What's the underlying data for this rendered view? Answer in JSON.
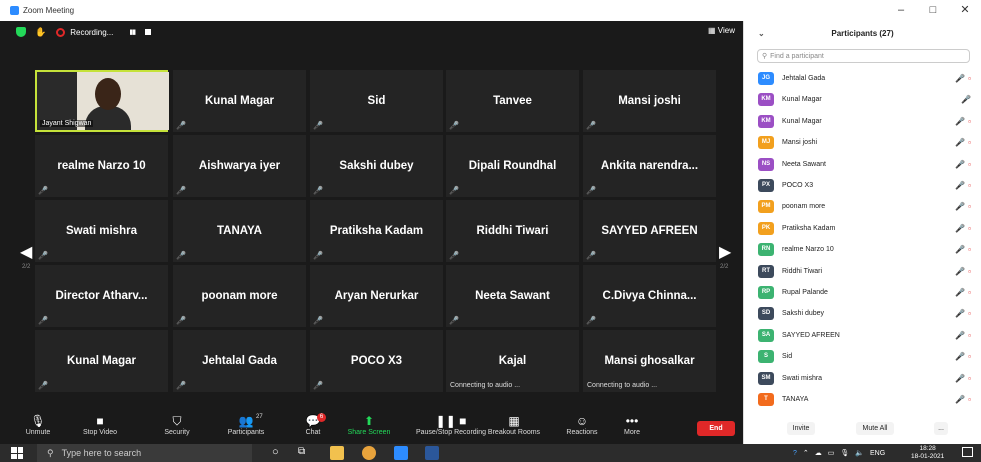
{
  "window": {
    "title": "Zoom Meeting",
    "controls": [
      "–",
      "□",
      "✕"
    ]
  },
  "topbar": {
    "recording_label": "Recording...",
    "view_label": "View"
  },
  "active_speaker": {
    "name": "Jayant Shigwan"
  },
  "tiles": [
    {
      "name": "Kunal Magar",
      "muted": true
    },
    {
      "name": "Sid",
      "muted": true
    },
    {
      "name": "Tanvee",
      "muted": true
    },
    {
      "name": "Mansi joshi",
      "muted": true
    },
    {
      "name": "realme Narzo 10",
      "muted": true
    },
    {
      "name": "Aishwarya iyer",
      "muted": true
    },
    {
      "name": "Sakshi dubey",
      "muted": true
    },
    {
      "name": "Dipali Roundhal",
      "muted": true
    },
    {
      "name": "Ankita narendra...",
      "muted": true
    },
    {
      "name": "Swati mishra",
      "muted": true
    },
    {
      "name": "TANAYA",
      "muted": true
    },
    {
      "name": "Pratiksha Kadam",
      "muted": true
    },
    {
      "name": "Riddhi Tiwari",
      "muted": true
    },
    {
      "name": "SAYYED AFREEN",
      "muted": true
    },
    {
      "name": "Director Atharv...",
      "muted": true
    },
    {
      "name": "poonam more",
      "muted": true
    },
    {
      "name": "Aryan Nerurkar",
      "muted": true
    },
    {
      "name": "Neeta Sawant",
      "muted": true
    },
    {
      "name": "C.Divya  Chinna...",
      "muted": true
    },
    {
      "name": "Kunal Magar",
      "muted": true
    },
    {
      "name": "Jehtalal Gada",
      "muted": true
    },
    {
      "name": "POCO X3",
      "muted": true
    },
    {
      "name": "Kajal",
      "muted": false,
      "status": "Connecting to audio ..."
    },
    {
      "name": "Mansi ghosalkar",
      "muted": false,
      "status": "Connecting to audio ..."
    }
  ],
  "paging": {
    "left_page": "2/2",
    "right_page": "2/2"
  },
  "toolbar": {
    "items": [
      {
        "label": "Unmute",
        "icon": "🎙"
      },
      {
        "label": "Stop Video",
        "icon": "■"
      },
      {
        "label": "Security",
        "icon": "⛉"
      },
      {
        "label": "Participants",
        "icon": "👥",
        "count": "27"
      },
      {
        "label": "Chat",
        "icon": "💬",
        "badge": "6"
      },
      {
        "label": "Share Screen",
        "icon": "⬆"
      },
      {
        "label": "Pause/Stop Recording",
        "icon": "❚❚ ■"
      },
      {
        "label": "Breakout Rooms",
        "icon": "▦"
      },
      {
        "label": "Reactions",
        "icon": "☺"
      },
      {
        "label": "More",
        "icon": "•••"
      }
    ],
    "end_label": "End"
  },
  "panel": {
    "title": "Participants (27)",
    "search_placeholder": "Find a participant",
    "participants": [
      {
        "initials": "JG",
        "name": "Jehtalal Gada",
        "color": "#2d8cff"
      },
      {
        "initials": "KM",
        "name": "Kunal Magar",
        "color": "#9b4fc4"
      },
      {
        "initials": "KM",
        "name": "Kunal Magar",
        "color": "#9b4fc4"
      },
      {
        "initials": "MJ",
        "name": "Mansi joshi",
        "color": "#f2a01e"
      },
      {
        "initials": "NS",
        "name": "Neeta Sawant",
        "color": "#9b4fc4"
      },
      {
        "initials": "PX",
        "name": "POCO X3",
        "color": "#3d4a5c"
      },
      {
        "initials": "PM",
        "name": "poonam more",
        "color": "#f2a01e"
      },
      {
        "initials": "PK",
        "name": "Pratiksha Kadam",
        "color": "#f2a01e"
      },
      {
        "initials": "RN",
        "name": "realme Narzo 10",
        "color": "#3cb371"
      },
      {
        "initials": "RT",
        "name": "Riddhi Tiwari",
        "color": "#3d4a5c"
      },
      {
        "initials": "RP",
        "name": "Rupal Palande",
        "color": "#3cb371"
      },
      {
        "initials": "SD",
        "name": "Sakshi dubey",
        "color": "#3d4a5c"
      },
      {
        "initials": "SA",
        "name": "SAYYED AFREEN",
        "color": "#3cb371"
      },
      {
        "initials": "S",
        "name": "Sid",
        "color": "#3cb371"
      },
      {
        "initials": "SM",
        "name": "Swati mishra",
        "color": "#3d4a5c"
      },
      {
        "initials": "T",
        "name": "TANAYA",
        "color": "#f26b1d"
      }
    ],
    "invite_label": "Invite",
    "mute_all_label": "Mute All",
    "more_label": "..."
  },
  "taskbar": {
    "search_placeholder": "Type here to search",
    "lang": "ENG",
    "time": "18:28",
    "date": "18-01-2021"
  }
}
